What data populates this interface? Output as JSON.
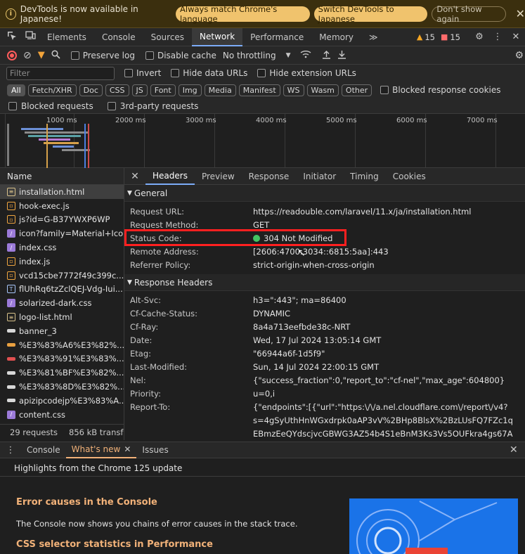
{
  "infobar": {
    "message": "DevTools is now available in Japanese!",
    "btn_match": "Always match Chrome's language",
    "btn_switch": "Switch DevTools to Japanese",
    "btn_dont": "Don't show again"
  },
  "tabs": [
    "Elements",
    "Console",
    "Sources",
    "Network",
    "Performance",
    "Memory"
  ],
  "badges": {
    "warnings": "15",
    "errors": "15"
  },
  "toolbar": {
    "preserve_log": "Preserve log",
    "disable_cache": "Disable cache",
    "throttling": "No throttling"
  },
  "filter": {
    "placeholder": "Filter",
    "invert": "Invert",
    "hide_data_urls": "Hide data URLs",
    "hide_ext_urls": "Hide extension URLs",
    "types": [
      "All",
      "Fetch/XHR",
      "Doc",
      "CSS",
      "JS",
      "Font",
      "Img",
      "Media",
      "Manifest",
      "WS",
      "Wasm",
      "Other"
    ],
    "blocked_cookies": "Blocked response cookies",
    "blocked_requests": "Blocked requests",
    "third_party": "3rd-party requests"
  },
  "timeline": {
    "ticks": [
      "1000 ms",
      "2000 ms",
      "3000 ms",
      "4000 ms",
      "5000 ms",
      "6000 ms",
      "7000 ms"
    ]
  },
  "list": {
    "header": "Name",
    "items": [
      {
        "name": "installation.html",
        "kind": "doc"
      },
      {
        "name": "hook-exec.js",
        "kind": "js"
      },
      {
        "name": "js?id=G-B37YWXP6WP",
        "kind": "js"
      },
      {
        "name": "icon?family=Material+Icons",
        "kind": "css"
      },
      {
        "name": "index.css",
        "kind": "css"
      },
      {
        "name": "index.js",
        "kind": "js"
      },
      {
        "name": "vcd15cbe7772f49c399c...",
        "kind": "js"
      },
      {
        "name": "flUhRq6tzZclQEJ-Vdg-Iui...",
        "kind": "font"
      },
      {
        "name": "solarized-dark.css",
        "kind": "css"
      },
      {
        "name": "logo-list.html",
        "kind": "doc"
      },
      {
        "name": "banner_3",
        "kind": "img"
      },
      {
        "name": "%E3%83%A6%E3%82%...",
        "kind": "img-o"
      },
      {
        "name": "%E3%83%91%E3%83%...",
        "kind": "img-r"
      },
      {
        "name": "%E3%81%BF%E3%82%...",
        "kind": "img"
      },
      {
        "name": "%E3%83%8D%E3%82%...",
        "kind": "img"
      },
      {
        "name": "apizipcodejp%E3%83%A...",
        "kind": "img"
      },
      {
        "name": "content.css",
        "kind": "css"
      }
    ],
    "footer_requests": "29 requests",
    "footer_transfer": "856 kB transfe"
  },
  "detail_tabs": [
    "Headers",
    "Preview",
    "Response",
    "Initiator",
    "Timing",
    "Cookies"
  ],
  "general": {
    "title": "General",
    "rows": [
      {
        "k": "Request URL:",
        "v": "https://readouble.com/laravel/11.x/ja/installation.html"
      },
      {
        "k": "Request Method:",
        "v": "GET"
      },
      {
        "k": "Status Code:",
        "v": "304 Not Modified"
      },
      {
        "k": "Remote Address:",
        "v": "[2606:4700:3034::6815:5aa]:443"
      },
      {
        "k": "Referrer Policy:",
        "v": "strict-origin-when-cross-origin"
      }
    ]
  },
  "response": {
    "title": "Response Headers",
    "rows": [
      {
        "k": "Alt-Svc:",
        "v": "h3=\":443\"; ma=86400"
      },
      {
        "k": "Cf-Cache-Status:",
        "v": "DYNAMIC"
      },
      {
        "k": "Cf-Ray:",
        "v": "8a4a713eefbde38c-NRT"
      },
      {
        "k": "Date:",
        "v": "Wed, 17 Jul 2024 13:05:14 GMT"
      },
      {
        "k": "Etag:",
        "v": "\"66944a6f-1d5f9\""
      },
      {
        "k": "Last-Modified:",
        "v": "Sun, 14 Jul 2024 22:00:15 GMT"
      },
      {
        "k": "Nel:",
        "v": "{\"success_fraction\":0,\"report_to\":\"cf-nel\",\"max_age\":604800}"
      },
      {
        "k": "Priority:",
        "v": "u=0,i"
      },
      {
        "k": "Report-To:",
        "v": "{\"endpoints\":[{\"url\":\"https:\\/\\/a.nel.cloudflare.com\\/report\\/v4?"
      }
    ],
    "report_cont1": "s=4gSyUthHnWGxdrpk0aAP3vV%2BHp8BlsX%2BzLUsFQ7FZc1q",
    "report_cont2": "EBmzEeQYdscjvcGBWG3AZ54b4S1eBnM3Ks3Vs5OUFkra4gs67A"
  },
  "drawer": {
    "tabs": [
      "Console",
      "What's new",
      "Issues"
    ],
    "highlights": "Highlights from the Chrome 125 update",
    "h1": "Error causes in the Console",
    "p1": "The Console now shows you chains of error causes in the stack trace.",
    "h2": "CSS selector statistics in Performance"
  }
}
